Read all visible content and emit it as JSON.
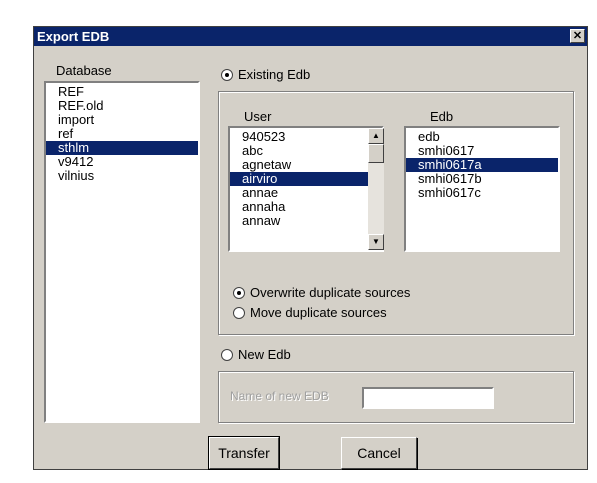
{
  "window": {
    "title": "Export EDB",
    "close_glyph": "✕"
  },
  "database": {
    "label": "Database",
    "items": [
      "REF",
      "REF.old",
      "import",
      "ref",
      "sthlm",
      "v9412",
      "vilnius"
    ],
    "selected": "sthlm"
  },
  "existing": {
    "radio_label": "Existing Edb",
    "selected": true,
    "user_label": "User",
    "users": [
      "940523",
      "abc",
      "agnetaw",
      "airviro",
      "annae",
      "annaha",
      "annaw"
    ],
    "user_selected": "airviro",
    "edb_label": "Edb",
    "edbs": [
      "edb",
      "smhi0617",
      "smhi0617a",
      "smhi0617b",
      "smhi0617c"
    ],
    "edb_selected": "smhi0617a",
    "overwrite_label": "Overwrite duplicate sources",
    "move_label": "Move duplicate sources",
    "overwrite_selected": true
  },
  "newedb": {
    "radio_label": "New Edb",
    "selected": false,
    "name_label": "Name of new EDB",
    "name_value": ""
  },
  "buttons": {
    "transfer": "Transfer",
    "cancel": "Cancel"
  },
  "icons": {
    "close": "close-icon",
    "scroll_up": "scroll-up-icon",
    "scroll_down": "scroll-down-icon"
  }
}
